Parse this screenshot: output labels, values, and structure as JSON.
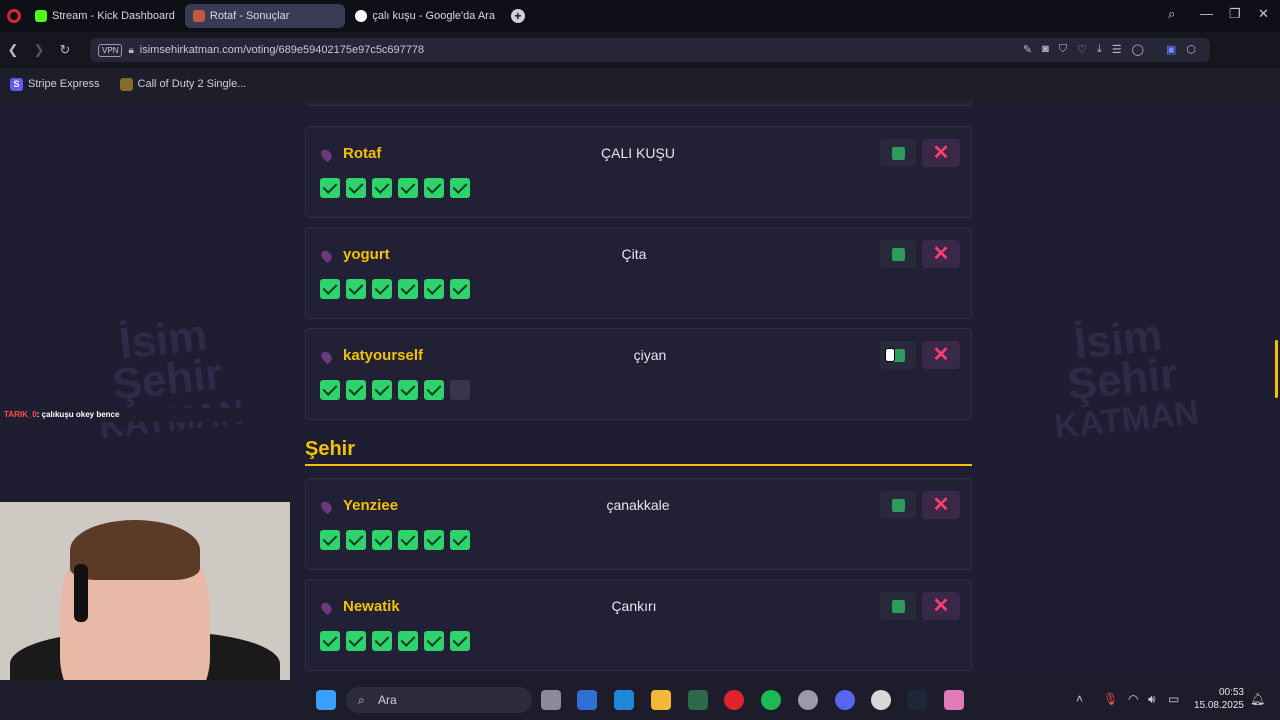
{
  "tabs": [
    {
      "label": "Stream - Kick Dashboard",
      "icon": "kick-icon"
    },
    {
      "label": "Rotaf - Sonuçlar",
      "icon": "site-icon",
      "active": true
    },
    {
      "label": "çalı kuşu - Google'da Ara",
      "icon": "google-icon"
    }
  ],
  "address": {
    "url": "isimsehirkatman.com/voting/689e59402175e97c5c697778",
    "vpn": "VPN"
  },
  "bookmarks": [
    {
      "label": "Stripe Express",
      "icon_text": "S"
    },
    {
      "label": "Call of Duty 2 Single..."
    }
  ],
  "chat": {
    "user": "TARIK_0",
    "message": ": çalıkuşu okey bence"
  },
  "watermark": {
    "line1": "İsim",
    "line2": "Şehir",
    "line3": "KATMAN"
  },
  "entries_top": [
    {
      "name": "Rotaf",
      "answer": "ÇALI KUŞU",
      "votes": [
        1,
        1,
        1,
        1,
        1,
        1
      ]
    },
    {
      "name": "yogurt",
      "answer": "Çita",
      "votes": [
        1,
        1,
        1,
        1,
        1,
        1
      ]
    },
    {
      "name": "katyourself",
      "answer": "çiyan",
      "votes": [
        1,
        1,
        1,
        1,
        1,
        0
      ]
    }
  ],
  "section": {
    "title": "Şehir"
  },
  "entries_city": [
    {
      "name": "Yenziee",
      "answer": "çanakkale",
      "votes": [
        1,
        1,
        1,
        1,
        1,
        1
      ]
    },
    {
      "name": "Newatik",
      "answer": "Çankırı",
      "votes": [
        1,
        1,
        1,
        1,
        1,
        1
      ]
    }
  ],
  "taskbar": {
    "search_placeholder": "Ara",
    "time": "00:53",
    "date": "15.08.2025"
  },
  "colors": {
    "accent": "#f2c200",
    "check": "#2ed36b",
    "reject": "#ff3f6e"
  }
}
